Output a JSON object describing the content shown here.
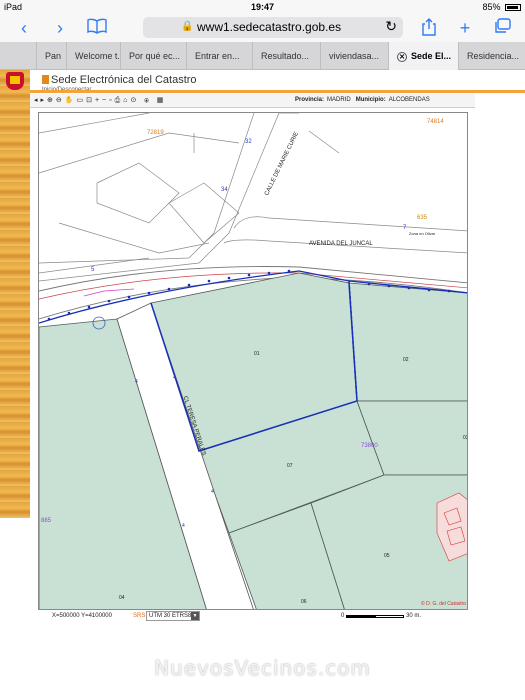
{
  "status_bar": {
    "device": "iPad",
    "time": "19:47",
    "battery": "85%"
  },
  "browser": {
    "url": "www1.sedecatastro.gob.es",
    "tabs": [
      {
        "label": "Pan",
        "active": false
      },
      {
        "label": "Welcome t...",
        "active": false
      },
      {
        "label": "Por qué ec...",
        "active": false
      },
      {
        "label": "Entrar en...",
        "active": false
      },
      {
        "label": "Resultado...",
        "active": false
      },
      {
        "label": "viviendasa...",
        "active": false
      },
      {
        "label": "Sede El...",
        "active": true
      },
      {
        "label": "Residencia...",
        "active": false
      }
    ],
    "icons": [
      "back-icon",
      "forward-icon",
      "bookmarks-icon",
      "lock-icon",
      "reload-icon",
      "share-icon",
      "new-tab-icon",
      "tabs-icon"
    ]
  },
  "site": {
    "title": "Sede Electrónica del Catastro",
    "subtitle": "Inicio/Desconectar",
    "provincia_label": "Provincia:",
    "provincia_value": "MADRID",
    "municipio_label": "Municipio:",
    "municipio_value": "ALCOBENDAS"
  },
  "map": {
    "street_labels": {
      "calle_marie_curie": "CALLE DE MARIE CURIE",
      "avenida_juncal": "AVENIDA DEL JUNCAL",
      "cl_teresa_perales": "CL TERESA PERALES",
      "zona_olivar": "Zona en Olivar"
    },
    "block_numbers": {
      "b72819": "72819",
      "b74814": "74814",
      "b73800": "73800",
      "b635": "635",
      "b885": "885"
    },
    "parcel_numbers": [
      "01",
      "02",
      "03",
      "04",
      "05",
      "06",
      "07"
    ],
    "street_numbers": {
      "n32": "32",
      "n34": "34",
      "n5": "5",
      "n7": "7",
      "n4a": "4",
      "n4b": "4",
      "n4c": "4",
      "n4d": "4"
    },
    "copyright": "© D. G. del Catastro",
    "coords": "X=500000 Y=4100000",
    "srs_label": "SRS:",
    "srs_value": "UTM 30 ETRS89",
    "scale_start": "0",
    "scale_end": "30 m."
  },
  "watermark": "NuevosVecinos.com",
  "colors": {
    "parcel_fill": "#c9e0d4",
    "selected_outline": "#1730b7",
    "accent_orange": "#f3a33a",
    "ios_blue": "#2f7cf6"
  }
}
